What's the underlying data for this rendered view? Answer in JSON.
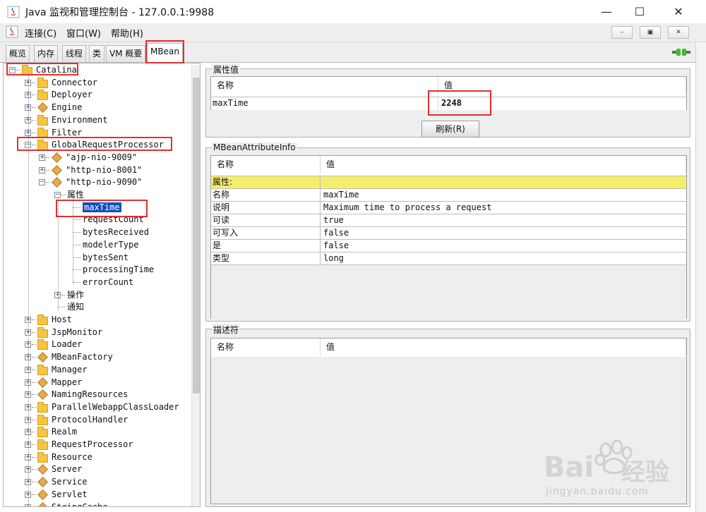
{
  "window": {
    "title": "Java 监视和管理控制台 - 127.0.0.1:9988",
    "controls": {
      "minimize": "—",
      "maximize": "☐",
      "close": "✕"
    }
  },
  "menu": {
    "items": [
      "连接(C)",
      "窗口(W)",
      "帮助(H)"
    ],
    "inner_controls": [
      "–",
      "▣",
      "✕"
    ]
  },
  "tabs": [
    "概览",
    "内存",
    "线程",
    "类",
    "VM 概要",
    "MBean"
  ],
  "active_tab": "MBean",
  "tree": {
    "root": "Catalina",
    "nodes_top": [
      "Connector",
      "Deployer",
      "Engine",
      "Environment",
      "Filter"
    ],
    "expanded": "GlobalRequestProcessor",
    "processors": [
      "\"ajp-nio-9009\"",
      "\"http-nio-8001\"",
      "\"http-nio-9090\""
    ],
    "attributes_folder": "属性",
    "attributes": [
      "maxTime",
      "requestCount",
      "bytesReceived",
      "modelerType",
      "bytesSent",
      "processingTime",
      "errorCount"
    ],
    "selected_attribute": "maxTime",
    "operations": "操作",
    "notifications": "通知",
    "nodes_bottom": [
      "Host",
      "JspMonitor",
      "Loader",
      "MBeanFactory",
      "Manager",
      "Mapper",
      "NamingResources",
      "ParallelWebappClassLoader",
      "ProtocolHandler",
      "Realm",
      "RequestProcessor",
      "Resource",
      "Server",
      "Service",
      "Servlet",
      "StringCache"
    ]
  },
  "attribute_value": {
    "title": "属性值",
    "col_name": "名称",
    "col_value": "值",
    "name": "maxTime",
    "value": "2248",
    "refresh_label": "刷新(R)"
  },
  "attribute_info": {
    "title": "MBeanAttributeInfo",
    "col_name": "名称",
    "col_value": "值",
    "section": "属性:",
    "rows": [
      {
        "name": "名称",
        "value": "maxTime"
      },
      {
        "name": "说明",
        "value": "Maximum time to process a request"
      },
      {
        "name": "可读",
        "value": "true"
      },
      {
        "name": "可写入",
        "value": "false"
      },
      {
        "name": "是",
        "value": "false"
      },
      {
        "name": "类型",
        "value": "long"
      }
    ]
  },
  "descriptor": {
    "title": "描述符",
    "col_name": "名称",
    "col_value": "值"
  },
  "watermark": {
    "brand": "Bai",
    "brand_cn": "经验",
    "url": "jingyan.baidu.com"
  },
  "colors": {
    "selection": "#0f4fbf",
    "annotation": "#e03030",
    "highlight_row": "#f5ee6a"
  }
}
